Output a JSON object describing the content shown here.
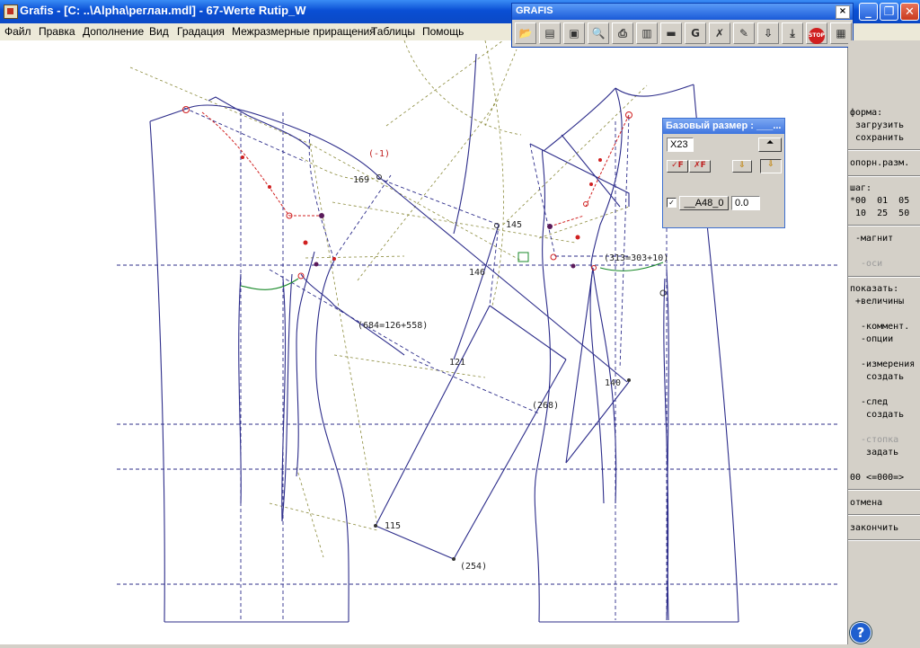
{
  "window": {
    "title": "Grafis - [C: ..\\Alpha\\реглан.mdl] - 67-Werte Rutip_W"
  },
  "menu": [
    "Файл",
    "Правка",
    "Дополнение",
    "Вид",
    "Градация",
    "Межразмерные приращения",
    "Таблицы",
    "Помощь"
  ],
  "toolbar": {
    "title": "GRAFIS",
    "close": "×",
    "tools": [
      "open-folder-icon",
      "open-file-icon",
      "save-icon",
      "search-icon",
      "print-icon",
      "layers-icon",
      "ruler-icon",
      "grading-icon",
      "delete-icon",
      "edit-icon",
      "download-icon",
      "download-all-icon",
      "stop-icon",
      "calculator-icon"
    ]
  },
  "base_size_dialog": {
    "title": "Базовый размер : ___...",
    "size_value": "X23",
    "model_label": "__A48_0",
    "model_value": "0.0"
  },
  "canvas_labels": {
    "l169": "169",
    "lminus1": "(-1)",
    "l145": "145",
    "l146": "146",
    "l313": "(313=303+10)",
    "l684": "(684=126+558)",
    "l121": "121",
    "l140": "140",
    "l268": "(268)",
    "l115": "115",
    "l254": "(254)"
  },
  "side_menu": {
    "forma": "форма:",
    "load": " загрузить",
    "save": " сохранить",
    "ref_size": "опорн.разм.",
    "step": "шаг:",
    "step_row1": "*00  01  05",
    "step_row2": " 10  25  50",
    "magnet": " -магнит",
    "axes": "  -оси",
    "show": "показать:",
    "values": " +величины",
    "comments": "  -коммент.",
    "options": "  -опции",
    "measures": "  -измерения",
    "create1": "   создать",
    "trace": "  -след",
    "create2": "   создать",
    "seam": "  -стопка",
    "set": "   задать",
    "nav": "00 <=000=>",
    "undo": "отмена",
    "finish": "закончить"
  },
  "colors": {
    "pattern_line": "#2c2c8a",
    "guide_line": "#8a8a3a",
    "red_point": "#d02020",
    "green_curve": "#1a8a2a"
  }
}
